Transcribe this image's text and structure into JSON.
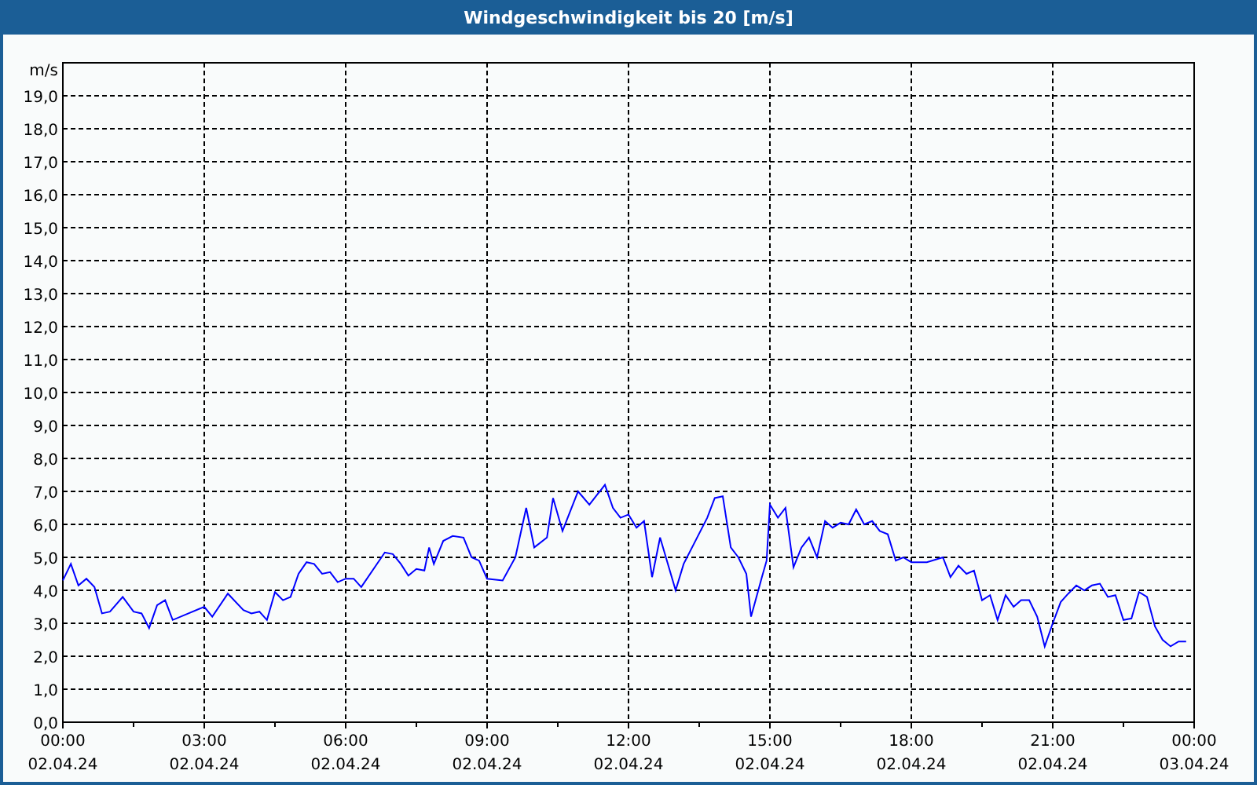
{
  "chart_data": {
    "type": "line",
    "title": "Windgeschwindigkeit bis 20 [m/s]",
    "ylabel": "m/s",
    "x": [
      0,
      0.17,
      0.33,
      0.5,
      0.67,
      0.83,
      1,
      1.27,
      1.5,
      1.67,
      1.83,
      2,
      2.17,
      2.33,
      3,
      3.17,
      3.5,
      3.83,
      4,
      4.17,
      4.33,
      4.5,
      4.67,
      4.83,
      5,
      5.17,
      5.33,
      5.5,
      5.67,
      5.83,
      6,
      6.17,
      6.33,
      6.83,
      7,
      7.17,
      7.33,
      7.5,
      7.67,
      7.77,
      7.87,
      8.07,
      8.27,
      8.5,
      8.67,
      8.83,
      9,
      9.33,
      9.6,
      9.83,
      10,
      10.27,
      10.4,
      10.6,
      10.93,
      11.17,
      11.5,
      11.67,
      11.83,
      12,
      12.17,
      12.33,
      12.5,
      12.67,
      13,
      13.17,
      13.67,
      13.83,
      14,
      14.17,
      14.33,
      14.5,
      14.6,
      14.83,
      14.93,
      15,
      15.17,
      15.33,
      15.5,
      15.67,
      15.83,
      16,
      16.17,
      16.33,
      16.5,
      16.67,
      16.83,
      17,
      17.17,
      17.33,
      17.5,
      17.67,
      17.83,
      18,
      18.33,
      18.67,
      18.83,
      19,
      19.17,
      19.33,
      19.5,
      19.67,
      19.83,
      20,
      20.17,
      20.33,
      20.5,
      20.67,
      20.83,
      21,
      21.17,
      21.33,
      21.5,
      21.67,
      21.83,
      22,
      22.17,
      22.33,
      22.5,
      22.67,
      22.83,
      23,
      23.17,
      23.33,
      23.5,
      23.67,
      23.83
    ],
    "series": [
      {
        "color": "#0000ff",
        "values": [
          4.3,
          4.8,
          4.15,
          4.35,
          4.1,
          3.3,
          3.35,
          3.8,
          3.35,
          3.3,
          2.85,
          3.55,
          3.7,
          3.1,
          3.5,
          3.2,
          3.9,
          3.4,
          3.3,
          3.35,
          3.1,
          3.95,
          3.7,
          3.8,
          4.5,
          4.85,
          4.8,
          4.5,
          4.55,
          4.25,
          4.35,
          4.35,
          4.1,
          5.15,
          5.1,
          4.8,
          4.45,
          4.65,
          4.6,
          5.3,
          4.8,
          5.5,
          5.65,
          5.6,
          5.0,
          4.9,
          4.35,
          4.3,
          5.0,
          6.5,
          5.3,
          5.6,
          6.8,
          5.8,
          7.0,
          6.6,
          7.2,
          6.5,
          6.2,
          6.3,
          5.9,
          6.1,
          4.4,
          5.6,
          4.0,
          4.8,
          6.2,
          6.8,
          6.85,
          5.3,
          5.0,
          4.5,
          3.2,
          4.4,
          4.9,
          6.6,
          6.2,
          6.5,
          4.7,
          5.3,
          5.6,
          5.0,
          6.1,
          5.9,
          6.05,
          6.0,
          6.45,
          6.0,
          6.1,
          5.8,
          5.7,
          4.9,
          5.0,
          4.85,
          4.85,
          5.0,
          4.4,
          4.75,
          4.5,
          4.6,
          3.7,
          3.85,
          3.1,
          3.85,
          3.5,
          3.7,
          3.7,
          3.2,
          2.3,
          3.0,
          3.65,
          3.9,
          4.15,
          4.0,
          4.15,
          4.2,
          3.8,
          3.85,
          3.1,
          3.15,
          3.95,
          3.8,
          2.9,
          2.5,
          2.3,
          2.45,
          2.45
        ]
      }
    ],
    "xlim": [
      0,
      24
    ],
    "ylim": [
      0,
      20
    ],
    "xticks": [
      {
        "value": 0,
        "label": "00:00"
      },
      {
        "value": 3,
        "label": "03:00"
      },
      {
        "value": 6,
        "label": "06:00"
      },
      {
        "value": 9,
        "label": "09:00"
      },
      {
        "value": 12,
        "label": "12:00"
      },
      {
        "value": 15,
        "label": "15:00"
      },
      {
        "value": 18,
        "label": "18:00"
      },
      {
        "value": 21,
        "label": "21:00"
      },
      {
        "value": 24,
        "label": "00:00"
      }
    ],
    "annotations": [
      "02.04.24",
      "02.04.24",
      "02.04.24",
      "02.04.24",
      "02.04.24",
      "02.04.24",
      "02.04.24",
      "02.04.24",
      "03.04.24"
    ],
    "grid": true,
    "yticks": [
      {
        "value": 0,
        "label": "0,0"
      },
      {
        "value": 1,
        "label": "1,0"
      },
      {
        "value": 2,
        "label": "2,0"
      },
      {
        "value": 3,
        "label": "3,0"
      },
      {
        "value": 4,
        "label": "4,0"
      },
      {
        "value": 5,
        "label": "5,0"
      },
      {
        "value": 6,
        "label": "6,0"
      },
      {
        "value": 7,
        "label": "7,0"
      },
      {
        "value": 8,
        "label": "8,0"
      },
      {
        "value": 9,
        "label": "9,0"
      },
      {
        "value": 10,
        "label": "10,0"
      },
      {
        "value": 11,
        "label": "11,0"
      },
      {
        "value": 12,
        "label": "12,0"
      },
      {
        "value": 13,
        "label": "13,0"
      },
      {
        "value": 14,
        "label": "14,0"
      },
      {
        "value": 15,
        "label": "15,0"
      },
      {
        "value": 16,
        "label": "16,0"
      },
      {
        "value": 17,
        "label": "17,0"
      },
      {
        "value": 18,
        "label": "18,0"
      },
      {
        "value": 19,
        "label": "19,0"
      }
    ]
  }
}
